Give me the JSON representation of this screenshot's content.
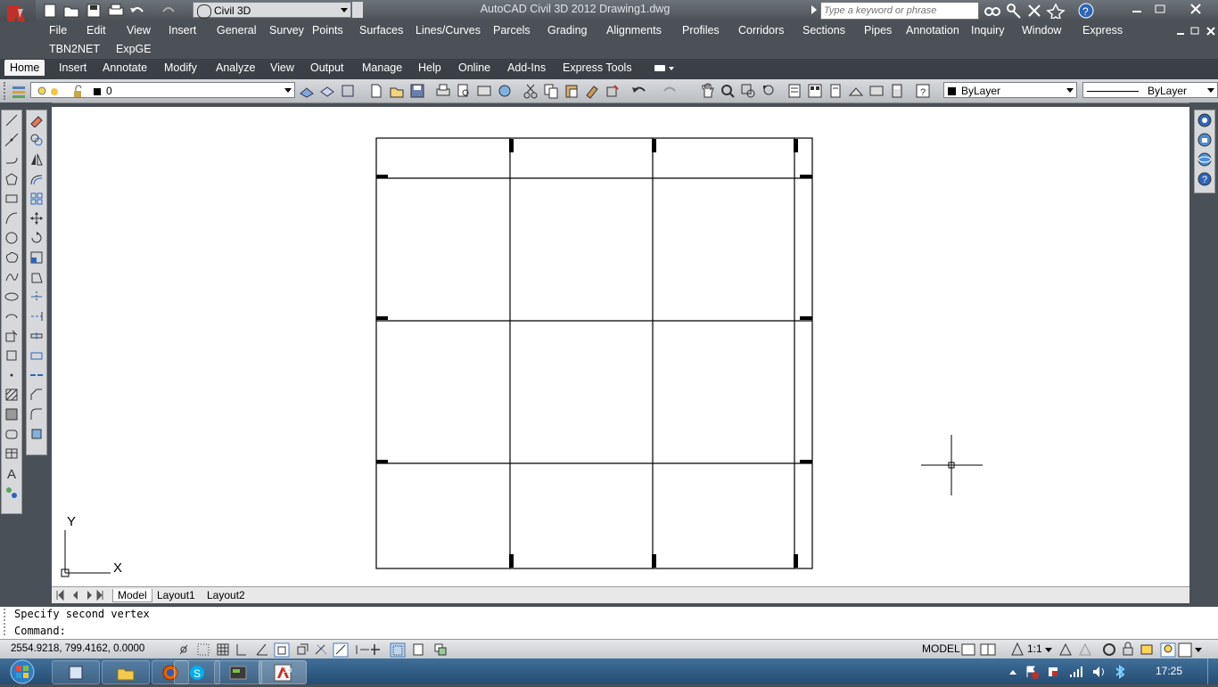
{
  "window": {
    "title": "AutoCAD Civil 3D 2012    Drawing1.dwg",
    "workspace": "Civil 3D",
    "search_placeholder": "Type a keyword or phrase",
    "app_badge": "3D"
  },
  "menus": {
    "row1": [
      "File",
      "Edit",
      "View",
      "Insert",
      "General",
      "Survey",
      "Points",
      "Surfaces",
      "Lines/Curves",
      "Parcels",
      "Grading",
      "Alignments",
      "Profiles",
      "Corridors",
      "Sections",
      "Pipes",
      "Annotation",
      "Inquiry",
      "Window",
      "Express"
    ],
    "row2": [
      "TBN2NET",
      "ExpGE"
    ]
  },
  "ribbon_tabs": [
    "Home",
    "Insert",
    "Annotate",
    "Modify",
    "Analyze",
    "View",
    "Output",
    "Manage",
    "Help",
    "Online",
    "Add-Ins",
    "Express Tools"
  ],
  "toolbar": {
    "layer_value": "0",
    "color_value": "ByLayer",
    "linetype_value": "ByLayer"
  },
  "layout_tabs": [
    "Model",
    "Layout1",
    "Layout2"
  ],
  "ucs": {
    "x_label": "X",
    "y_label": "Y"
  },
  "command": {
    "history": "Specify second vertex",
    "prompt": "Command:"
  },
  "status": {
    "coordinates": "2554.9218, 799.4162, 0.0000",
    "space": "MODEL",
    "annotation_scale": "1:1"
  },
  "taskbar": {
    "clock": "17:25",
    "app_badge": "3D"
  },
  "colors": {
    "accent": "#c0302a",
    "chrome_dark": "#4c5157",
    "canvas": "#ffffff"
  }
}
